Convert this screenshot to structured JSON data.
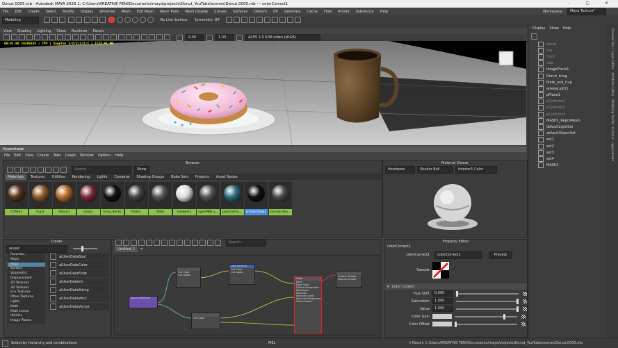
{
  "titlebar": {
    "title": "Donut.0005.mb - Autodesk MAYA 2026.1: C:\\Users\\KREATIVE PENI\\Documents\\maya\\projects\\Donut_YouTube\\scenes\\Donut.0005.mb --- colorCorrect1"
  },
  "menubar": {
    "items": [
      "File",
      "Edit",
      "Create",
      "Select",
      "Modify",
      "Display",
      "Windows",
      "Mesh",
      "Edit Mesh",
      "Mesh Tools",
      "Mesh Display",
      "Curves",
      "Surfaces",
      "Deform",
      "UV",
      "Generate",
      "Cache",
      "Flow",
      "Arnold",
      "Substance",
      "Help"
    ],
    "workspace_label": "Workspace:",
    "workspace_value": "Maya Texture*"
  },
  "statusline": {
    "mode": "Modeling",
    "live_surface": "No Live Surface",
    "symmetry": "Symmetry: Off"
  },
  "viewport_menu": [
    "View",
    "Shading",
    "Lighting",
    "Show",
    "Renderer",
    "Panels"
  ],
  "viewport_toolbar": {
    "value1": "0.00",
    "value2": "1.00",
    "colorspace": "ACES 1.0 SDR-video (sRGB)"
  },
  "viewport": {
    "hud": "00:01:06 16296325 | CPU | Samples 3/2/2/2/2/2 | 2122.81 MB"
  },
  "outliner": {
    "menu": [
      "Display",
      "Show",
      "Help"
    ],
    "items": [
      {
        "label": "persp",
        "dim": true
      },
      {
        "label": "top",
        "dim": true
      },
      {
        "label": "front",
        "dim": true
      },
      {
        "label": "side",
        "dim": true
      },
      {
        "label": "imagePlane1",
        "dim": false
      },
      {
        "label": "Donut_Icing",
        "dim": false
      },
      {
        "label": "Plate_and_Cup",
        "dim": false
      },
      {
        "label": "aiAreaLight1",
        "dim": false
      },
      {
        "label": "pPlane1",
        "dim": false
      },
      {
        "label": "pCylinder1",
        "dim": true
      },
      {
        "label": "pCylinder2",
        "dim": true
      },
      {
        "label": "pCylinder3",
        "dim": true
      },
      {
        "label": "MASH1_ReproMesh",
        "dim": false
      },
      {
        "label": "defaultLightSet",
        "dim": false
      },
      {
        "label": "defaultObjectSet",
        "dim": false
      },
      {
        "label": "set1",
        "dim": false
      },
      {
        "label": "set2",
        "dim": false
      },
      {
        "label": "set3",
        "dim": false
      },
      {
        "label": "set4",
        "dim": false
      },
      {
        "label": "MASH1",
        "dim": false
      }
    ]
  },
  "right_tabs": [
    "Channel Box / Layer Editor",
    "Attribute Editor",
    "Modeling Toolkit",
    "Outliner",
    "Hypershade"
  ],
  "hypershade": {
    "title": "Hypershade",
    "menu": [
      "File",
      "Edit",
      "View",
      "Create",
      "Tabs",
      "Graph",
      "Window",
      "Options",
      "Help"
    ],
    "browser_title": "Browser",
    "search_placeholder": "Search...",
    "show_label": "Show",
    "tabs": [
      "Materials",
      "Textures",
      "Utilities",
      "Rendering",
      "Lights",
      "Cameras",
      "Shading Groups",
      "Bake Sets",
      "Projects",
      "Asset Nodes"
    ],
    "swatches": [
      {
        "label": "Coffee1",
        "color": "#5a3418"
      },
      {
        "label": "Cup1",
        "color": "#8a5a2a"
      },
      {
        "label": "Donut1",
        "color": "#b06a2a"
      },
      {
        "label": "Icing1",
        "color": "#7a2a3a"
      },
      {
        "label": "Icing_Sticks",
        "color": "#111111"
      },
      {
        "label": "Plate1",
        "color": "#444444"
      },
      {
        "label": "Table",
        "color": "#555555"
      },
      {
        "label": "lambert1",
        "color": "#dddddd"
      },
      {
        "label": "openPBR_s...",
        "color": "#555555"
      },
      {
        "label": "particleClo...",
        "color": "#2a6a7a"
      },
      {
        "label": "shaderGlow1",
        "color": "#111111"
      },
      {
        "label": "standardSu...",
        "color": "#4a4a4a"
      }
    ],
    "material_viewer": {
      "title": "Material Viewer",
      "renderer": "Hardware",
      "shape": "Shader Ball",
      "env": "Interior1 Color"
    },
    "create": {
      "title": "Create",
      "search_value": "aiuser",
      "categories": [
        "Favorites",
        "Maya",
        "Maps",
        "Surface",
        "Volumetric",
        "Displacement",
        "2D Textures",
        "3D Textures",
        "Env Textures",
        "Other Textures",
        "Lights",
        "Math",
        "Math Linear",
        "Utilities",
        "Image Planes"
      ],
      "nodes": [
        "aiUserDataBool",
        "aiUserDataColor",
        "aiUserDataFloat",
        "aiUserDataInt",
        "aiUserDataString",
        "aiUserDataVec2",
        "aiUserDataVector"
      ]
    },
    "graph": {
      "tab": "Untitled_1",
      "search_placeholder": "Search..."
    },
    "property_editor": {
      "title": "Property Editor",
      "node_type": "colorCorrect1",
      "name_label": "colorCorrect1",
      "name_value": "colorCorrect1",
      "presets": "Presets",
      "sample_label": "Sample",
      "section": "Color Correct",
      "attrs": [
        {
          "name": "Hue Shift",
          "value": "0.000",
          "pos": 0.0
        },
        {
          "name": "Saturation",
          "value": "1.000",
          "pos": 1.0
        },
        {
          "name": "Value",
          "value": "1.000",
          "pos": 1.0
        },
        {
          "name": "Color Gain",
          "value": "",
          "pos": 0.8
        },
        {
          "name": "Color Offset",
          "value": "",
          "pos": 0.0
        }
      ]
    }
  },
  "helpline": {
    "text": "Select by hierarchy and combinations",
    "mel": "MEL",
    "result": "// Result: C:/Users/KREATIVE PENI/Documents/maya/projects/Donut_YouTube/scenes/Donut.0005.mb"
  }
}
